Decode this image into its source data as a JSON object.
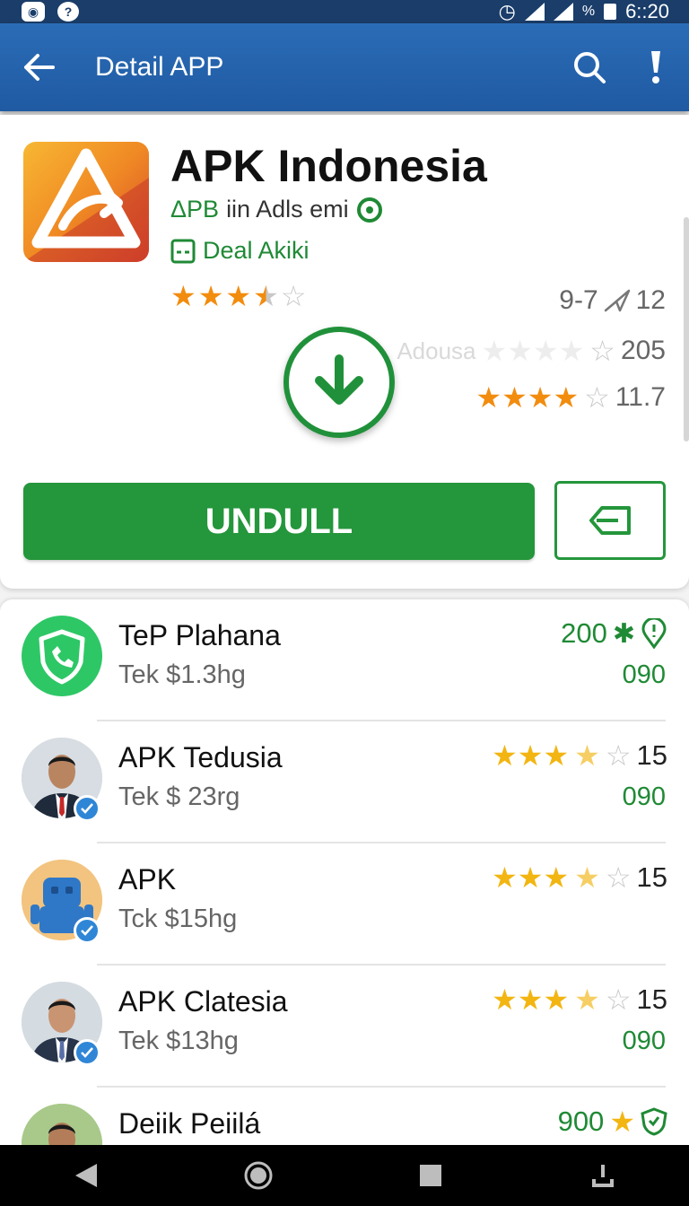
{
  "status_bar": {
    "battery_pct": "%",
    "time": "6::20"
  },
  "app_bar": {
    "title": "Detail APP"
  },
  "app": {
    "title": "APK Indonesia",
    "developer_prefix": "ΔPB",
    "developer": "iin Adls emi",
    "deal_label": "Deal Akiki",
    "rating_stars": 3.5,
    "stat1": "9-7",
    "stat1_value": "12",
    "stat2_faint": "Adousa",
    "stat2_value": "205",
    "stat3_value": "11.7",
    "install_label": "UNDULL"
  },
  "list": [
    {
      "title": "TeP Plahana",
      "subtitle": "Tek $1.3hg",
      "top_value": "200",
      "bottom_value": "090",
      "stars": null
    },
    {
      "title": "APK Tedusia",
      "subtitle": "Tek $ 23rg",
      "top_value": "15",
      "bottom_value": "090",
      "stars": 3.5
    },
    {
      "title": "APK",
      "subtitle": "Tck $15hg",
      "top_value": "15",
      "bottom_value": "",
      "stars": 3.5
    },
    {
      "title": "APK Clatesia",
      "subtitle": "Tek $13hg",
      "top_value": "15",
      "bottom_value": "090",
      "stars": 3.5
    },
    {
      "title": "Deiik Peiilá",
      "subtitle": "",
      "top_value": "900",
      "bottom_value": "",
      "stars": null
    }
  ],
  "colors": {
    "primary": "#2b6cb6",
    "accent_green": "#24963b",
    "star_orange": "#f28c0f",
    "star_gold": "#f2b511"
  }
}
